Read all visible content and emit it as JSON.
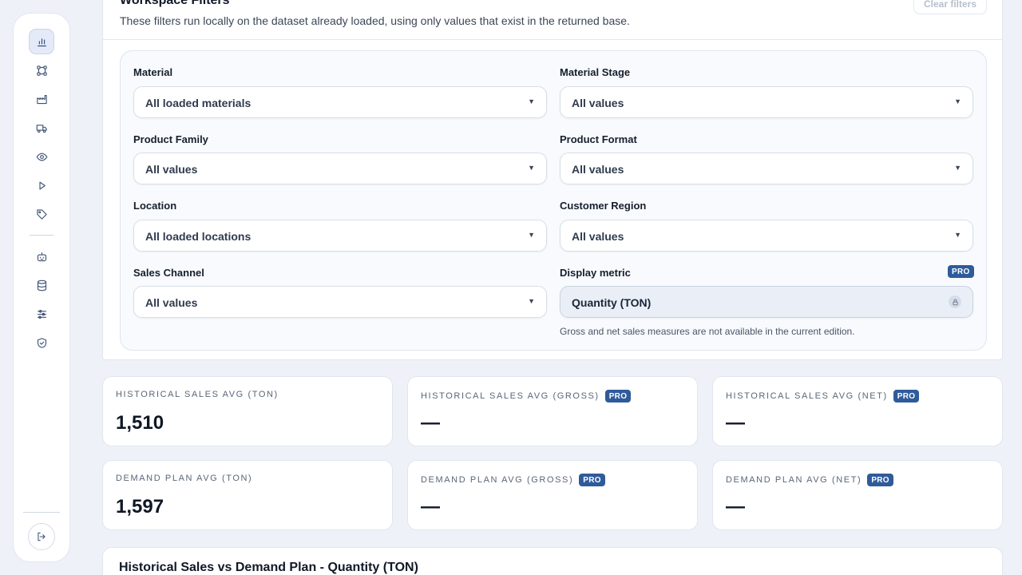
{
  "sidebar": {
    "items": [
      {
        "icon": "bar-chart-icon",
        "active": true
      },
      {
        "icon": "nodes-icon"
      },
      {
        "icon": "factory-icon"
      },
      {
        "icon": "truck-icon"
      },
      {
        "icon": "eye-icon"
      },
      {
        "icon": "play-icon"
      },
      {
        "icon": "tag-icon"
      },
      {
        "icon": "robot-icon"
      },
      {
        "icon": "database-icon"
      },
      {
        "icon": "sliders-icon"
      },
      {
        "icon": "shield-check-icon"
      }
    ],
    "logout_icon": "logout-icon"
  },
  "filters": {
    "title": "Workspace Filters",
    "subtitle": "These filters run locally on the dataset already loaded, using only values that exist in the returned base.",
    "clear_label": "Clear filters",
    "fields": {
      "material": {
        "label": "Material",
        "value": "All loaded materials"
      },
      "material_stage": {
        "label": "Material Stage",
        "value": "All values"
      },
      "product_family": {
        "label": "Product Family",
        "value": "All values"
      },
      "product_format": {
        "label": "Product Format",
        "value": "All values"
      },
      "location": {
        "label": "Location",
        "value": "All loaded locations"
      },
      "customer_region": {
        "label": "Customer Region",
        "value": "All values"
      },
      "sales_channel": {
        "label": "Sales Channel",
        "value": "All values"
      },
      "display_metric": {
        "label": "Display metric",
        "value": "Quantity (TON)",
        "badge": "PRO",
        "note": "Gross and net sales measures are not available in the current edition."
      }
    }
  },
  "kpis": [
    {
      "label": "HISTORICAL SALES AVG (TON)",
      "value": "1,510",
      "badge": ""
    },
    {
      "label": "HISTORICAL SALES AVG (GROSS)",
      "value": "—",
      "badge": "PRO"
    },
    {
      "label": "HISTORICAL SALES AVG (NET)",
      "value": "—",
      "badge": "PRO"
    },
    {
      "label": "DEMAND PLAN AVG (TON)",
      "value": "1,597",
      "badge": ""
    },
    {
      "label": "DEMAND PLAN AVG (GROSS)",
      "value": "—",
      "badge": "PRO"
    },
    {
      "label": "DEMAND PLAN AVG (NET)",
      "value": "—",
      "badge": "PRO"
    }
  ],
  "chart": {
    "title": "Historical Sales vs Demand Plan - Quantity (TON)"
  },
  "colors": {
    "accent": "#2f5b9a",
    "background": "#eef1f7"
  }
}
